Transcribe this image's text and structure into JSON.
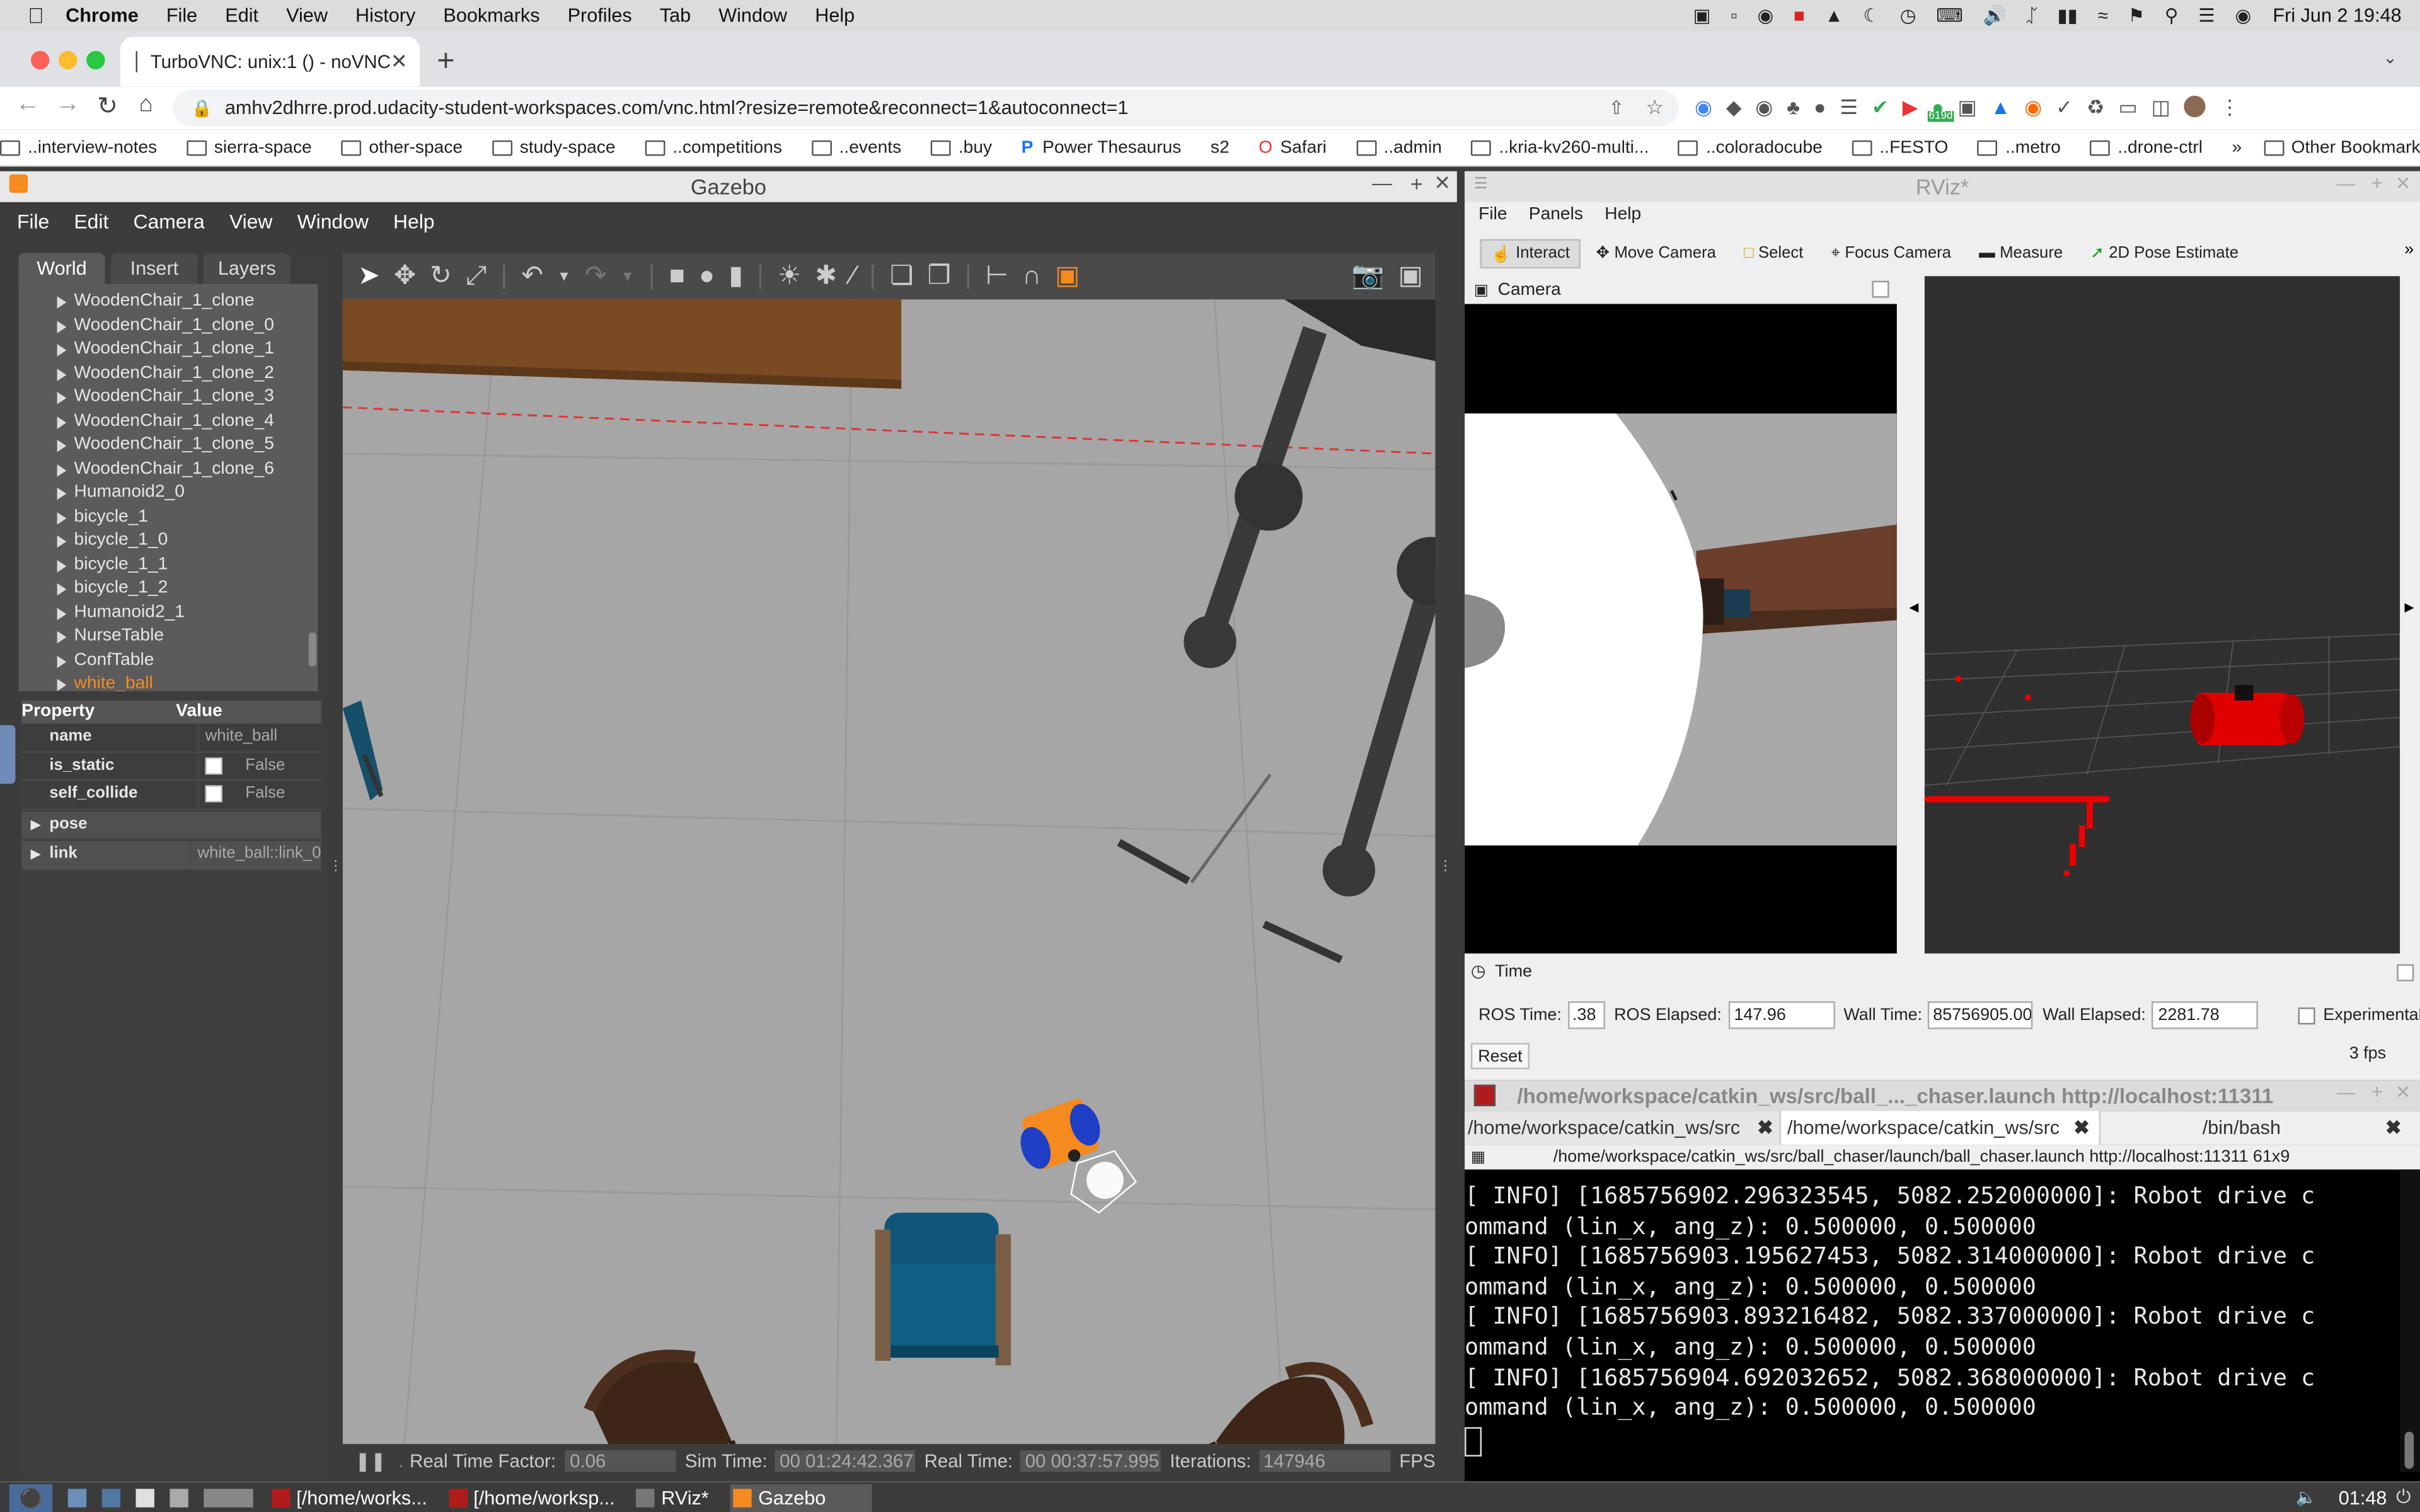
{
  "mac_menubar": {
    "app": "Chrome",
    "menus": [
      "File",
      "Edit",
      "View",
      "History",
      "Bookmarks",
      "Profiles",
      "Tab",
      "Window",
      "Help"
    ],
    "date_time": "Fri Jun 2  19:48"
  },
  "browser": {
    "tab_title": "TurboVNC: unix:1 () - noVNC",
    "url": "amhv2dhrre.prod.udacity-student-workspaces.com/vnc.html?resize=remote&reconnect=1&autoconnect=1",
    "extension_badge": "619d",
    "bookmarks": [
      "..interview-notes",
      "sierra-space",
      "other-space",
      "study-space",
      "..competitions",
      "..events",
      ".buy",
      "Power Thesaurus",
      "s2",
      "Safari",
      "..admin",
      "..kria-kv260-multi...",
      "..coloradocube",
      "..FESTO",
      "..metro",
      "..drone-ctrl"
    ],
    "other_bookmarks": "Other Bookmarks",
    "more": "»"
  },
  "gazebo": {
    "title": "Gazebo",
    "menus": [
      "File",
      "Edit",
      "Camera",
      "View",
      "Window",
      "Help"
    ],
    "tabs": [
      "World",
      "Insert",
      "Layers"
    ],
    "tree": [
      "WoodenChair_1_clone",
      "WoodenChair_1_clone_0",
      "WoodenChair_1_clone_1",
      "WoodenChair_1_clone_2",
      "WoodenChair_1_clone_3",
      "WoodenChair_1_clone_4",
      "WoodenChair_1_clone_5",
      "WoodenChair_1_clone_6",
      "Humanoid2_0",
      "bicycle_1",
      "bicycle_1_0",
      "bicycle_1_1",
      "bicycle_1_2",
      "Humanoid2_1",
      "NurseTable",
      "ConfTable",
      "white_ball"
    ],
    "props_header": {
      "property": "Property",
      "value": "Value"
    },
    "props": [
      {
        "k": "name",
        "v": "white_ball"
      },
      {
        "k": "is_static",
        "v": "False"
      },
      {
        "k": "self_collide",
        "v": "False"
      }
    ],
    "groups": [
      {
        "k": "pose",
        "v": ""
      },
      {
        "k": "link",
        "v": "white_ball::link_0"
      }
    ],
    "status": {
      "rtf_label": "Real Time Factor:",
      "rtf": "0.06",
      "sim_label": "Sim Time:",
      "sim": "00 01:24:42.367",
      "real_label": "Real Time:",
      "real": "00 00:37:57.995",
      "iter_label": "Iterations:",
      "iter": "147946",
      "fps_label": "FPS"
    }
  },
  "rviz": {
    "title": "RViz*",
    "menus": [
      "File",
      "Panels",
      "Help"
    ],
    "tools": [
      "Interact",
      "Move Camera",
      "Select",
      "Focus Camera",
      "Measure",
      "2D Pose Estimate"
    ],
    "camera_panel": "Camera",
    "time_panel": "Time",
    "ros_time_label": "ROS Time:",
    "ros_time": ".38",
    "ros_elapsed_label": "ROS Elapsed:",
    "ros_elapsed": "147.96",
    "wall_time_label": "Wall Time:",
    "wall_time": "85756905.00",
    "wall_elapsed_label": "Wall Elapsed:",
    "wall_elapsed": "2281.78",
    "experimental": "Experimental",
    "reset": "Reset",
    "fps": "3 fps"
  },
  "terminal": {
    "title": "/home/workspace/catkin_ws/src/ball_..._chaser.launch http://localhost:11311",
    "tabs": [
      "/home/workspace/catkin_ws/src",
      "/home/workspace/catkin_ws/src",
      "/bin/bash"
    ],
    "subtitle": "/home/workspace/catkin_ws/src/ball_chaser/launch/ball_chaser.launch http://localhost:11311 61x9",
    "lines": [
      "[ INFO] [1685756902.296323545, 5082.252000000]: Robot drive c",
      "ommand (lin_x, ang_z): 0.500000, 0.500000",
      "[ INFO] [1685756903.195627453, 5082.314000000]: Robot drive c",
      "ommand (lin_x, ang_z): 0.500000, 0.500000",
      "[ INFO] [1685756903.893216482, 5082.337000000]: Robot drive c",
      "ommand (lin_x, ang_z): 0.500000, 0.500000",
      "[ INFO] [1685756904.692032652, 5082.368000000]: Robot drive c",
      "ommand (lin_x, ang_z): 0.500000, 0.500000"
    ]
  },
  "taskbar": {
    "items": [
      "[/home/works...",
      "[/home/worksp...",
      "RViz*",
      "Gazebo"
    ],
    "clock": "01:48"
  },
  "colors": {
    "gazebo_bg": "#3c3c3c",
    "ground": "#a6a6a6",
    "terminal_bg": "#000000",
    "accent_orange": "#f58a1f"
  }
}
